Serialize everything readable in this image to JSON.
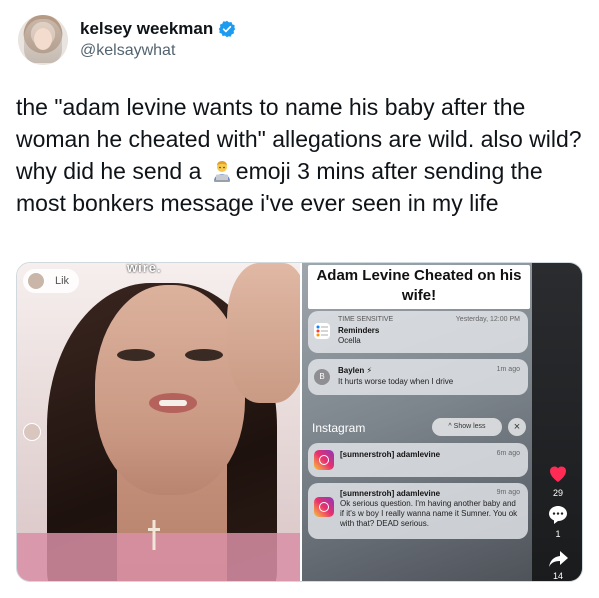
{
  "tweet": {
    "display_name": "kelsey weekman",
    "handle": "@kelsaywhat",
    "text_part1": "the \"adam levine wants to name his baby after the woman he cheated with\" allegations are wild. also wild? why did he send a ",
    "text_part2": "emoji 3 mins after sending the most bonkers message i've ever seen in my life",
    "emoji_name": "man-technologist-emoji",
    "verified_color": "#1d9bf0"
  },
  "media": {
    "left": {
      "like_chip": "Lik",
      "caption_cut": "wire."
    },
    "right": {
      "video_title_line1": "Adam Levine Cheated on his",
      "video_title_line2": "wife!",
      "notifications": [
        {
          "meta": "TIME SENSITIVE",
          "time": "Yesterday, 12:00 PM",
          "title": "Reminders",
          "body": "Ocella"
        },
        {
          "meta": "",
          "time": "1m ago",
          "title": "Baylen ⚡",
          "body": "It hurts worse today when I drive"
        }
      ],
      "section_label": "Instagram",
      "show_less": "^ Show less",
      "close": "×",
      "ig_notifications": [
        {
          "time": "6m ago",
          "title": "[sumnerstroh] adamlevine",
          "body": ""
        },
        {
          "time": "9m ago",
          "title": "[sumnerstroh] adamlevine",
          "body": "Ok serious question. I'm having another baby and if it's w boy I really wanna name it Sumner. You ok with that? DEAD serious."
        }
      ],
      "side": {
        "like_count": "29",
        "comment_count": "1",
        "share_count": "14"
      }
    }
  },
  "colors": {
    "text": "#0f1419",
    "secondary": "#536471",
    "like_red": "#fe2c55"
  }
}
